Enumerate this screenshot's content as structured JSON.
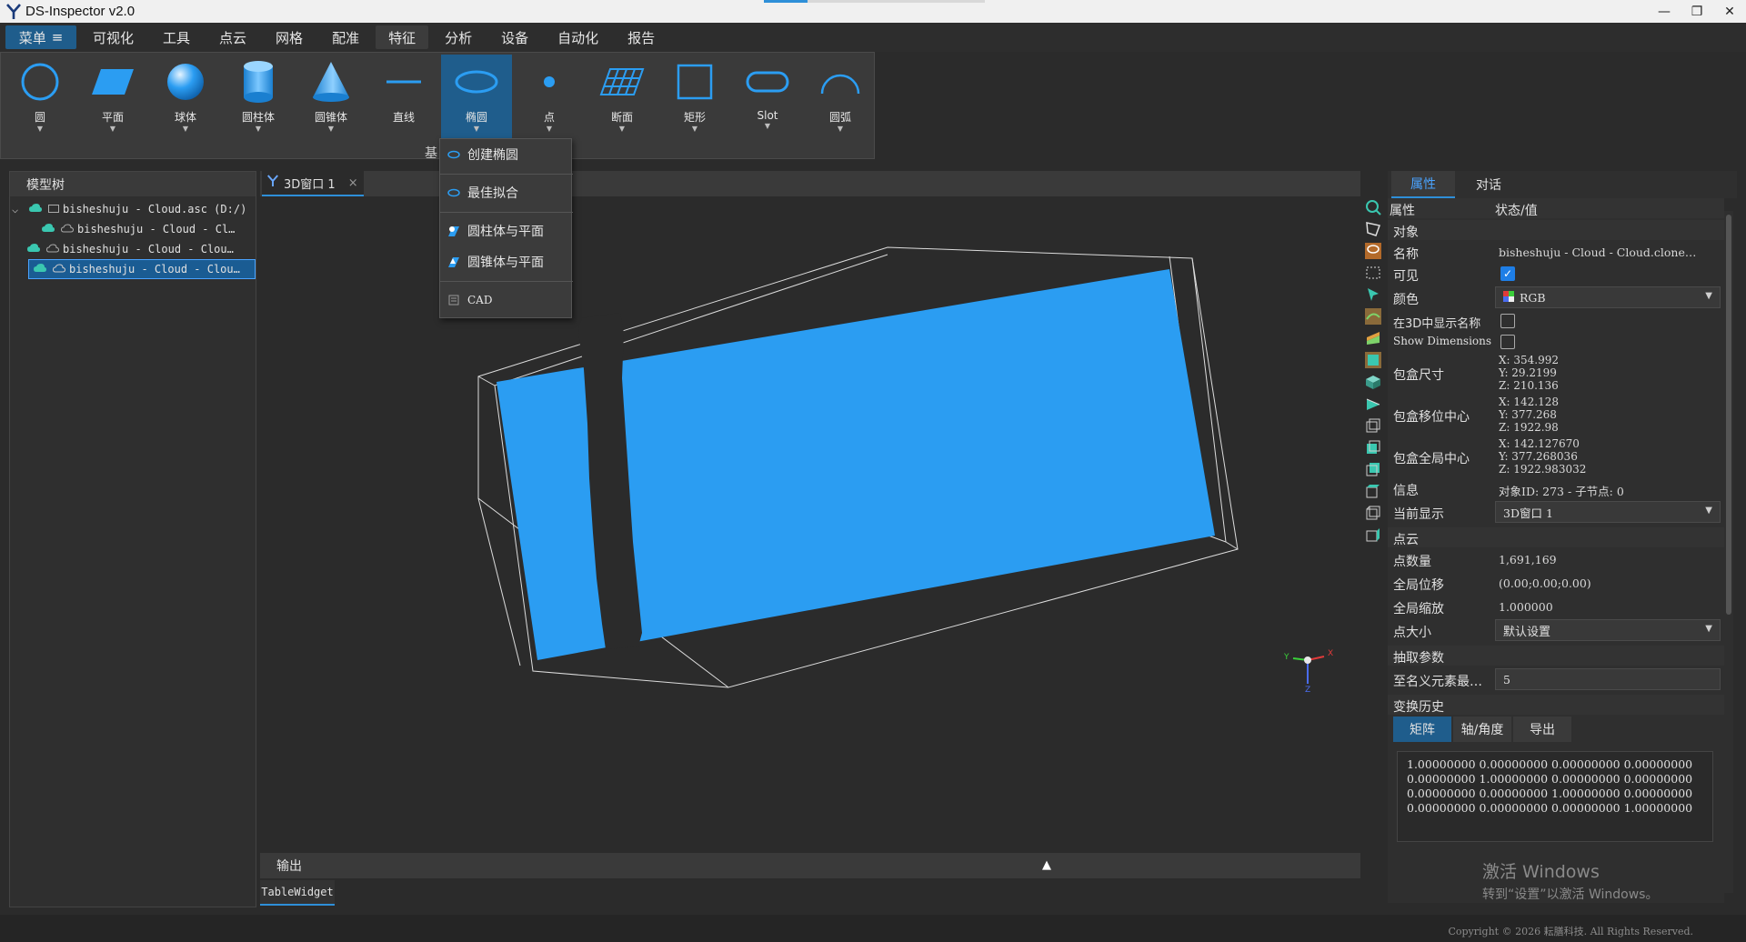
{
  "window": {
    "title": "DS-Inspector v2.0",
    "minimize": "—",
    "maximize": "❐",
    "close": "✕"
  },
  "menubar": {
    "main_menu": "菜单",
    "items": [
      "可视化",
      "工具",
      "点云",
      "网格",
      "配准",
      "特征",
      "分析",
      "设备",
      "自动化",
      "报告"
    ],
    "active_index": 5
  },
  "ribbon": {
    "tools": [
      {
        "label": "圆",
        "icon": "circle-icon"
      },
      {
        "label": "平面",
        "icon": "plane-icon"
      },
      {
        "label": "球体",
        "icon": "sphere-icon"
      },
      {
        "label": "圆柱体",
        "icon": "cylinder-icon"
      },
      {
        "label": "圆锥体",
        "icon": "cone-icon"
      },
      {
        "label": "直线",
        "icon": "line-icon"
      },
      {
        "label": "椭圆",
        "icon": "ellipse-icon"
      },
      {
        "label": "点",
        "icon": "point-icon"
      },
      {
        "label": "断面",
        "icon": "section-icon"
      },
      {
        "label": "矩形",
        "icon": "rectangle-icon"
      },
      {
        "label": "Slot",
        "icon": "slot-icon"
      },
      {
        "label": "圆弧",
        "icon": "arc-icon"
      }
    ],
    "active_tool": "椭圆",
    "group_label": "基"
  },
  "dropdown": {
    "items": [
      "创建椭圆",
      "最佳拟合",
      "圆柱体与平面",
      "圆锥体与平面",
      "CAD"
    ]
  },
  "model_tree": {
    "header": "模型树",
    "rows": [
      {
        "text": "bisheshuju - Cloud.asc (D:/)"
      },
      {
        "text": "bisheshuju - Cloud - Cl…"
      },
      {
        "text": "bisheshuju - Cloud - Clou…"
      },
      {
        "text": "bisheshuju - Cloud - Clou…"
      }
    ]
  },
  "viewport": {
    "tab_label": "3D窗口 1",
    "tab_close": "×",
    "axes": {
      "x": "X",
      "y": "Y",
      "z": "Z"
    },
    "output_label": "输出",
    "table_widget_tab": "TableWidget"
  },
  "properties": {
    "tabs": [
      "属性",
      "对话"
    ],
    "columns": {
      "key": "属性",
      "value": "状态/值"
    },
    "section_object": "对象",
    "name_label": "名称",
    "name_value": "bisheshuju - Cloud - Cloud.clone…",
    "visible_label": "可见",
    "color_label": "颜色",
    "color_value": "RGB",
    "show_name_label": "在3D中显示名称",
    "show_dims_label": "Show Dimensions",
    "bbox_size_label": "包盒尺寸",
    "bbox_size": [
      "X: 354.992",
      "Y: 29.2199",
      "Z: 210.136"
    ],
    "bbox_shift_label": "包盒移位中心",
    "bbox_shift": [
      "X: 142.128",
      "Y: 377.268",
      "Z: 1922.98"
    ],
    "bbox_global_label": "包盒全局中心",
    "bbox_global": [
      "X: 142.127670",
      "Y: 377.268036",
      "Z: 1922.983032"
    ],
    "info_label": "信息",
    "info_value": "对象ID: 273 - 子节点: 0",
    "current_display_label": "当前显示",
    "current_display_value": "3D窗口 1",
    "section_cloud": "点云",
    "point_count_label": "点数量",
    "point_count": "1,691,169",
    "global_shift_label": "全局位移",
    "global_shift": "(0.00;0.00;0.00)",
    "global_scale_label": "全局缩放",
    "global_scale": "1.000000",
    "point_size_label": "点大小",
    "point_size": "默认设置",
    "section_subsample": "抽取参数",
    "min_elements_label": "至名义元素最…",
    "min_elements": "5",
    "section_history": "变换历史",
    "history_tabs": [
      "矩阵",
      "轴/角度",
      "导出"
    ],
    "matrix": "1.00000000 0.00000000 0.00000000 0.00000000\n0.00000000 1.00000000 0.00000000 0.00000000\n0.00000000 0.00000000 1.00000000 0.00000000\n0.00000000 0.00000000 0.00000000 1.00000000"
  },
  "activation": {
    "line1": "激活 Windows",
    "line2": "转到“设置”以激活 Windows。"
  },
  "status": {
    "copyright": "Copyright © 2026 耘膳科技. All Rights Reserved."
  },
  "colors": {
    "accent": "#2e8fd8",
    "cloud_blue": "#2b9df2",
    "panel": "#2f2f2f"
  }
}
